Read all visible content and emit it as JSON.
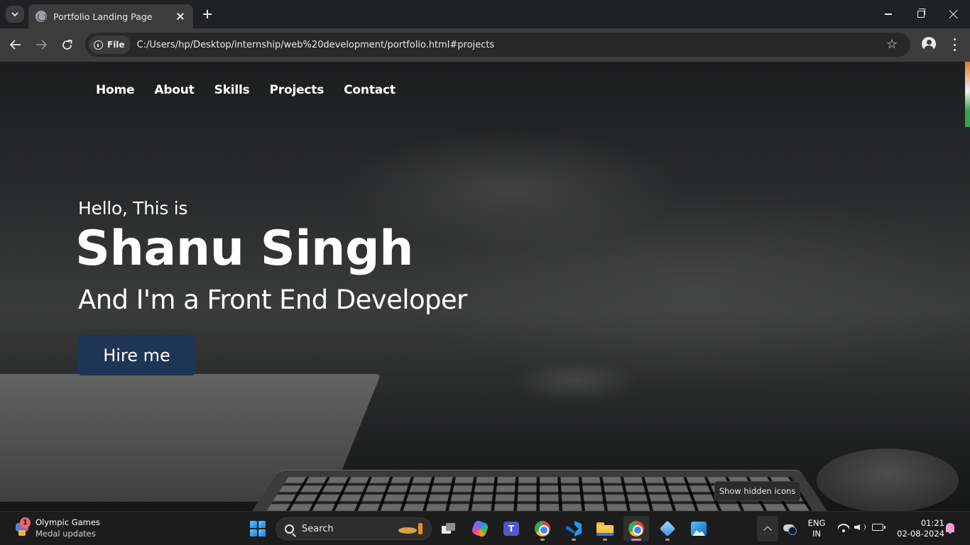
{
  "browser": {
    "tab_title": "Portfolio Landing Page",
    "file_chip_label": "File",
    "url": "C:/Users/hp/Desktop/internship/web%20development/portfolio.html#projects",
    "back_icon": "arrow-left-icon",
    "forward_icon": "arrow-right-icon",
    "reload_icon": "reload-icon"
  },
  "site": {
    "nav": [
      "Home",
      "About",
      "Skills",
      "Projects",
      "Contact"
    ],
    "greeting": "Hello, This is",
    "name": "Shanu Singh",
    "role": "And I'm a Front End Developer",
    "cta": "Hire me",
    "cta_color": "#1f3556"
  },
  "tooltip": "Show hidden icons",
  "taskbar": {
    "widget_title": "Olympic Games",
    "widget_subtitle": "Medal updates",
    "widget_badge": "1",
    "search_placeholder": "Search",
    "language_line1": "ENG",
    "language_line2": "IN",
    "time": "01:21",
    "date": "02-08-2024",
    "apps": [
      "task-view",
      "copilot",
      "teams",
      "chrome",
      "vscode",
      "file-explorer",
      "chrome-active",
      "virtualbox",
      "photos"
    ]
  }
}
